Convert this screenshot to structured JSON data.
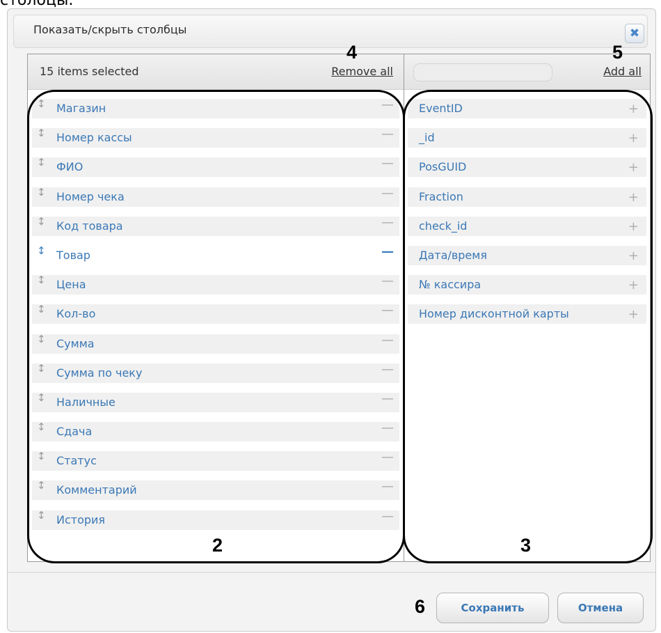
{
  "background": {
    "text": "столбцы."
  },
  "dialog": {
    "title": "Показать/скрыть столбцы"
  },
  "left": {
    "count_label": "15 items selected",
    "remove_all": "Remove all",
    "items": [
      {
        "label": "Магазин",
        "highlighted": false
      },
      {
        "label": "Номер кассы",
        "highlighted": false
      },
      {
        "label": "ФИО",
        "highlighted": false
      },
      {
        "label": "Номер чека",
        "highlighted": false
      },
      {
        "label": "Код товара",
        "highlighted": false
      },
      {
        "label": "Товар",
        "highlighted": true
      },
      {
        "label": "Цена",
        "highlighted": false
      },
      {
        "label": "Кол-во",
        "highlighted": false
      },
      {
        "label": "Сумма",
        "highlighted": false
      },
      {
        "label": "Сумма по чеку",
        "highlighted": false
      },
      {
        "label": "Наличные",
        "highlighted": false
      },
      {
        "label": "Сдача",
        "highlighted": false
      },
      {
        "label": "Статус",
        "highlighted": false
      },
      {
        "label": "Комментарий",
        "highlighted": false
      },
      {
        "label": "История",
        "highlighted": false
      }
    ]
  },
  "right": {
    "search": {
      "value": "",
      "placeholder": ""
    },
    "add_all": "Add all",
    "items": [
      {
        "label": "EventID"
      },
      {
        "label": "_id"
      },
      {
        "label": "PosGUID"
      },
      {
        "label": "Fraction"
      },
      {
        "label": "check_id"
      },
      {
        "label": "Дата/время"
      },
      {
        "label": "№ кассира"
      },
      {
        "label": "Номер дисконтной карты"
      }
    ]
  },
  "footer": {
    "save_label": "Сохранить",
    "cancel_label": "Отмена"
  },
  "annotations": {
    "m2": "2",
    "m3": "3",
    "m4": "4",
    "m5": "5",
    "m6": "6"
  },
  "icons": {
    "close": "close-icon",
    "drag": "drag-handle-icon",
    "remove": "minus-icon",
    "add": "plus-icon"
  },
  "colors": {
    "link_blue": "#3b78b5",
    "highlight_blue": "#3d7fc2",
    "dialog_bg": "#f3f3f3"
  }
}
